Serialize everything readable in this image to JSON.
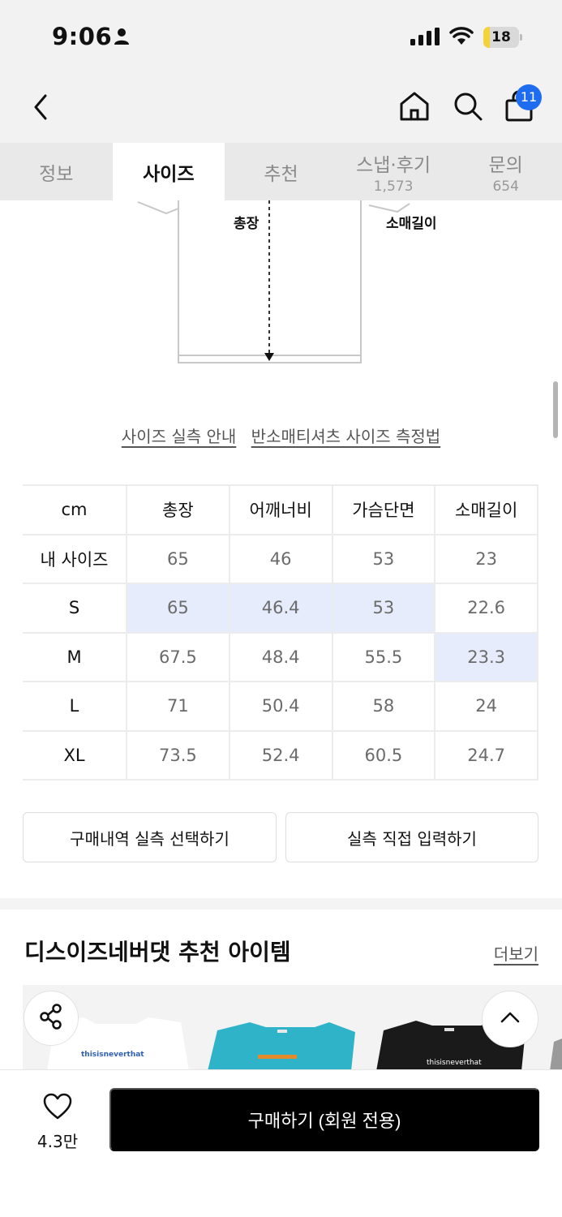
{
  "status_bar": {
    "time": "9:06",
    "battery": "18",
    "battery_level": 0.18
  },
  "tabs": [
    {
      "label": "정보",
      "count": ""
    },
    {
      "label": "사이즈",
      "count": ""
    },
    {
      "label": "추천",
      "count": ""
    },
    {
      "label": "스냅·후기",
      "count": "1,573"
    },
    {
      "label": "문의",
      "count": "654"
    }
  ],
  "active_tab": "사이즈",
  "header": {
    "cart_count": "11"
  },
  "diagram": {
    "length_label": "총장",
    "sleeve_label": "소매길이"
  },
  "links": {
    "guide": "사이즈 실측 안내",
    "method": "반소매티셔츠 사이즈 측정법"
  },
  "size_table": {
    "headers": [
      "cm",
      "총장",
      "어깨너비",
      "가슴단면",
      "소매길이"
    ],
    "rows": [
      {
        "label": "내 사이즈",
        "values": [
          "65",
          "46",
          "53",
          "23"
        ]
      },
      {
        "label": "S",
        "values": [
          "65",
          "46.4",
          "53",
          "22.6"
        ]
      },
      {
        "label": "M",
        "values": [
          "67.5",
          "48.4",
          "55.5",
          "23.3"
        ]
      },
      {
        "label": "L",
        "values": [
          "71",
          "50.4",
          "58",
          "24"
        ]
      },
      {
        "label": "XL",
        "values": [
          "73.5",
          "52.4",
          "60.5",
          "24.7"
        ]
      }
    ]
  },
  "buttons": {
    "select_history": "구매내역 실측 선택하기",
    "direct_input": "실측 직접 입력하기"
  },
  "recommend": {
    "title": "디스이즈네버댓 추천 아이템",
    "more": "더보기",
    "items": [
      {
        "brand_text": "thisisneverthat",
        "color": "#ffffff"
      },
      {
        "brand_text": "",
        "color": "#2fb3c8"
      },
      {
        "brand_text": "thisisneverthat",
        "color": "#1a1a1a"
      }
    ]
  },
  "bottom_bar": {
    "like_count": "4.3만",
    "buy_label": "구매하기 (회원 전용)"
  },
  "colors": {
    "highlight": "#e6ecfb",
    "badge": "#1e6cf0",
    "buy_button": "#000000"
  }
}
